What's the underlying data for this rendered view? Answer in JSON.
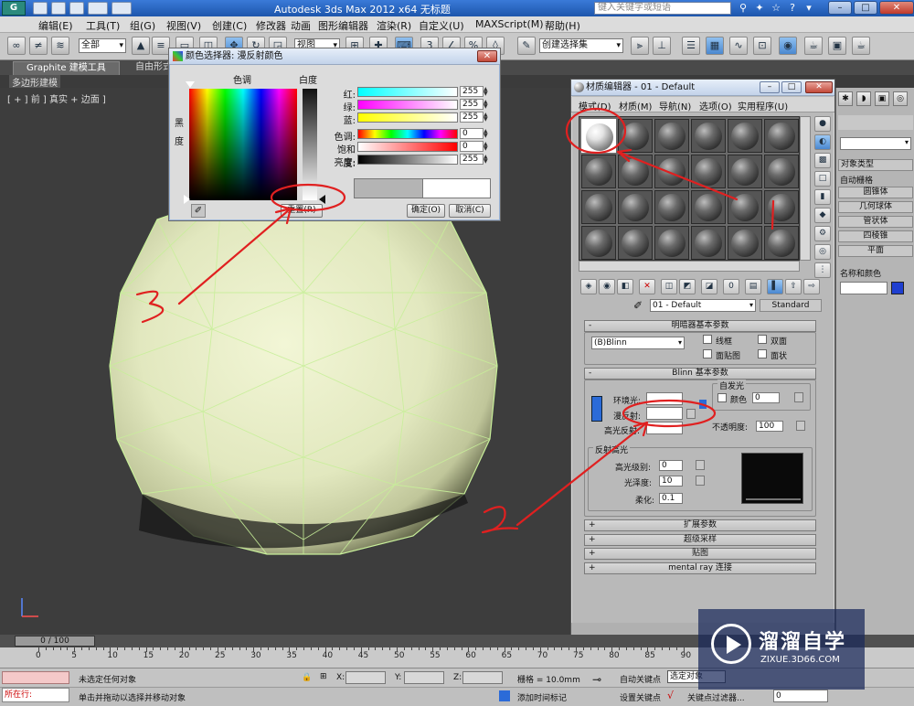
{
  "titlebar": {
    "app_icon": "3ds-max-logo",
    "title": "Autodesk 3ds Max  2012 x64     无标题",
    "search_placeholder": "键入关键字或短语"
  },
  "menu": [
    "编辑(E)",
    "工具(T)",
    "组(G)",
    "视图(V)",
    "创建(C)",
    "修改器",
    "动画",
    "图形编辑器",
    "渲染(R)",
    "自定义(U)",
    "MAXScript(M)",
    "帮助(H)"
  ],
  "toolbar": {
    "selection_filter": "全部",
    "reference_coord": "视图",
    "named_selection": "创建选择集"
  },
  "ribbon": {
    "tabs": [
      "Graphite 建模工具",
      "自由形式"
    ],
    "sub_tab": "多边形建模"
  },
  "viewport": {
    "label": "[ + ] 前 ] 真实 + 边面 ]"
  },
  "color_selector": {
    "title": "颜色选择器: 漫反射颜色",
    "hue_label": "色调",
    "whiteness_label": "白度",
    "blackness_label": "黑\n度",
    "channels": [
      {
        "label": "红:",
        "value": "255",
        "gradient": "linear-gradient(to right,#00ffff,#ffffff)"
      },
      {
        "label": "绿:",
        "value": "255",
        "gradient": "linear-gradient(to right,#ff00ff,#ffffff)"
      },
      {
        "label": "蓝:",
        "value": "255",
        "gradient": "linear-gradient(to right,#ffff00,#ffffff)"
      },
      {
        "label": "色调:",
        "value": "0",
        "gradient": "linear-gradient(to right,#f00,#ff0,#0f0,#0ff,#00f,#f0f,#f00)"
      },
      {
        "label": "饱和度:",
        "value": "0",
        "gradient": "linear-gradient(to right,#ffffff,#ff0000)"
      },
      {
        "label": "亮度:",
        "value": "255",
        "gradient": "linear-gradient(to right,#000000,#ffffff)"
      }
    ],
    "reset_button": "重置(R)",
    "ok_button": "确定(O)",
    "cancel_button": "取消(C)"
  },
  "material_editor": {
    "title": "材质编辑器 - 01 - Default",
    "menu": [
      "模式(D)",
      "材质(M)",
      "导航(N)",
      "选项(O)",
      "实用程序(U)"
    ],
    "material_name": "01 - Default",
    "material_type": "Standard",
    "shader_rollout": "明暗器基本参数",
    "shader": "(B)Blinn",
    "wire": "线框",
    "two_sided": "双面",
    "face_map": "面贴图",
    "faceted": "面状",
    "blinn_rollout": "Blinn 基本参数",
    "self_illum": "自发光",
    "color_label": "颜色",
    "self_illum_value": "0",
    "ambient": "环境光:",
    "diffuse": "漫反射:",
    "specular": "高光反射:",
    "opacity": "不透明度:",
    "opacity_value": "100",
    "spec_highlights": "反射高光",
    "spec_level": "高光级别:",
    "spec_level_value": "0",
    "glossiness": "光泽度:",
    "glossiness_value": "10",
    "soften": "柔化:",
    "soften_value": "0.1",
    "collapsed_rollouts": [
      "扩展参数",
      "超级采样",
      "贴图",
      "mental ray 连接"
    ]
  },
  "command_panel": {
    "object_type": "对象类型",
    "auto_grid": "自动栅格",
    "primitives": [
      "圆锥体",
      "几何球体",
      "管状体",
      "四棱锥",
      "平面"
    ],
    "name_color": "名称和颜色",
    "object_color": "#1f3fd0"
  },
  "timeline": {
    "frame": "0 / 100",
    "ticks": [
      "0",
      "5",
      "10",
      "15",
      "20",
      "25",
      "30",
      "35",
      "40",
      "45",
      "50",
      "55",
      "60",
      "65",
      "70",
      "75",
      "80",
      "85",
      "90"
    ]
  },
  "status": {
    "selection": "未选定任何对象",
    "prompt": "单击并拖动以选择并移动对象",
    "script_box": "所在行:",
    "x_label": "X:",
    "y_label": "Y:",
    "z_label": "Z:",
    "grid": "栅格 = 10.0mm",
    "auto_key": "自动关键点",
    "set_key": "设置关键点",
    "key_mode": "选定对象",
    "key_filters": "关键点过滤器...",
    "add_time_tag": "添加时间标记",
    "frame_field": "0"
  },
  "watermark": {
    "brand": "溜溜自学",
    "url": "ZIXUE.3D66.COM"
  },
  "annotations": {
    "color": "#e02020",
    "marks": [
      "1",
      "2",
      "3"
    ]
  }
}
